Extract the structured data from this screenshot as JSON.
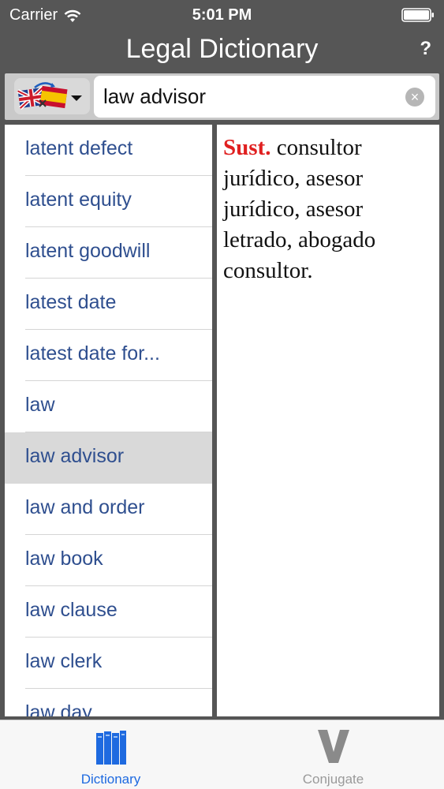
{
  "status_bar": {
    "carrier": "Carrier",
    "time": "5:01 PM"
  },
  "nav": {
    "title": "Legal Dictionary",
    "help_label": "?"
  },
  "search": {
    "value": "law advisor",
    "clear_label": "×"
  },
  "word_list": {
    "items": [
      "latent defect",
      "latent equity",
      "latent goodwill",
      "latest date",
      "latest date for...",
      "law",
      "law advisor",
      "law and order",
      "law book",
      "law clause",
      "law clerk",
      "law day"
    ],
    "selected": "law advisor"
  },
  "definition": {
    "part_of_speech": "Sust.",
    "text": " consultor jurídico, asesor jurídico, asesor letrado, abogado consultor."
  },
  "tab_bar": {
    "tabs": [
      {
        "label": "Dictionary",
        "icon": "books-icon",
        "active": true
      },
      {
        "label": "Conjugate",
        "icon": "letter-v-icon",
        "active": false
      }
    ]
  },
  "colors": {
    "bar_background": "#565656",
    "list_text": "#2f4f8f",
    "selected_row": "#d9d9d9",
    "part_of_speech": "#e02020",
    "tab_active": "#1e6ae0",
    "tab_inactive": "#9a9a9a"
  }
}
